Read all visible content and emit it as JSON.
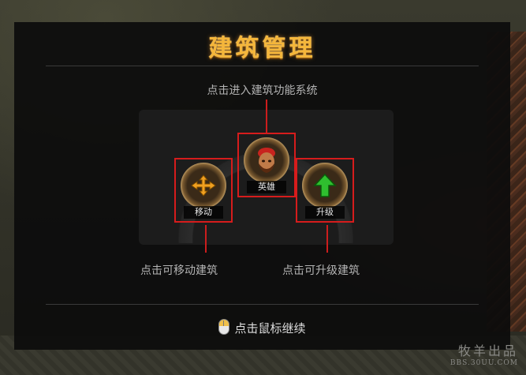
{
  "dialog": {
    "title": "建筑管理",
    "top_caption": "点击进入建筑功能系统",
    "left_caption": "点击可移动建筑",
    "right_caption": "点击可升级建筑",
    "continue_text": "点击鼠标继续"
  },
  "buttons": [
    {
      "label": "移动",
      "icon": "move-cross-icon"
    },
    {
      "label": "英雄",
      "icon": "hero-portrait-icon"
    },
    {
      "label": "升级",
      "icon": "upgrade-arrow-icon"
    }
  ],
  "watermark": {
    "line1": "牧羊出品",
    "line2": "BBS.30UU.COM"
  },
  "colors": {
    "title_gold": "#f5b63a",
    "highlight_red": "#d61c1c",
    "upgrade_green": "#2fbf2f",
    "move_orange": "#f0a020"
  }
}
